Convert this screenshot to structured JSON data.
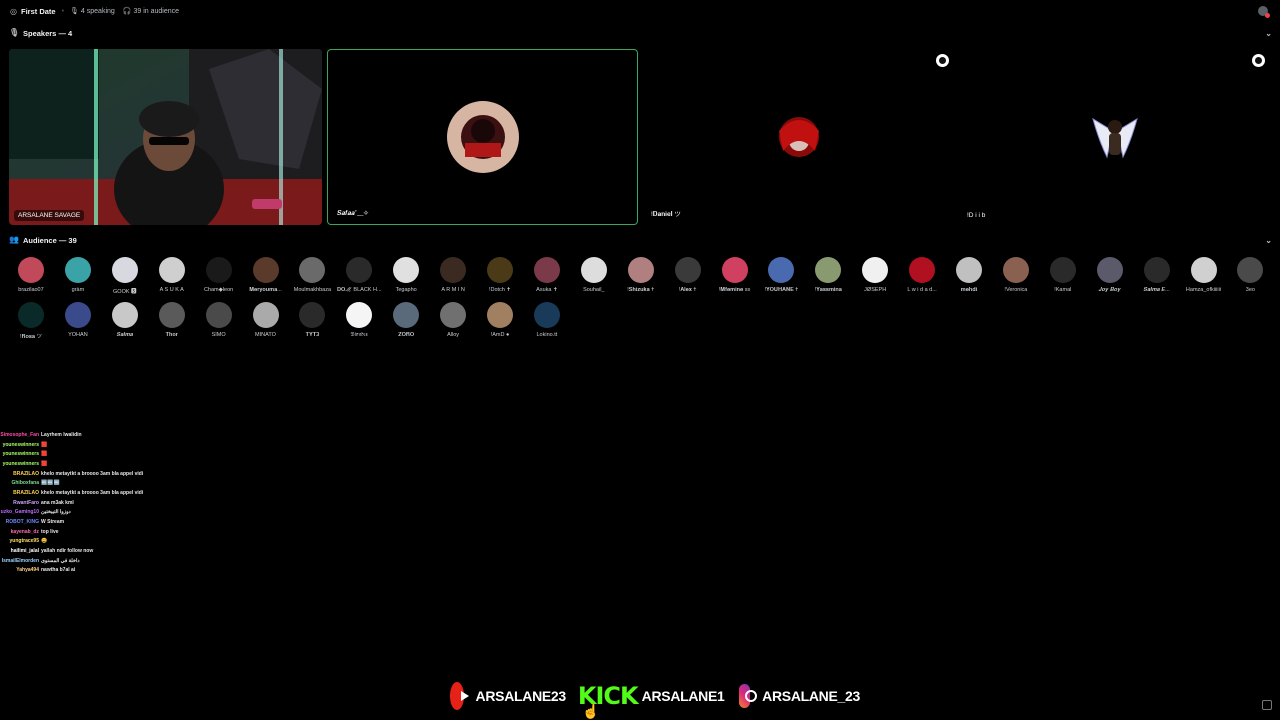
{
  "topbar": {
    "title": "First Date",
    "speaking": "4 speaking",
    "audience": "39 in audience"
  },
  "speakers_header": "Speakers — 4",
  "audience_header": "Audience — 39",
  "speakers": [
    {
      "name": "ARSALANE SAVAGE",
      "bg": "#1a2a24"
    },
    {
      "name": "𝑺𝒂𝒇𝒂𝒂˚﹏✧",
      "bg": "#c2a18c"
    },
    {
      "name": "!𝐃𝐚𝐧𝐢𝐞𝐥 ツ",
      "bg": "#2a070a"
    },
    {
      "name": "!D i i b",
      "bg": "#b3a899"
    }
  ],
  "audience_members": [
    "brazilao07",
    "gràm",
    "GOOK 🆂",
    "A S U K A",
    "Cham◆leon",
    "𝐌𝐞𝐫𝐲𝐨𝐮𝐦𝐚...",
    "Moulmakhbaza",
    "𝐃𝐎ℳ BLACK H...",
    "Tegapho",
    "A R M I N",
    "!Dotch ✝",
    "Asuka ✝",
    "Souhail_",
    "!𝐒𝐡𝐢𝐳𝐮𝐤𝐚 ✝",
    "!𝐀𝐥𝐞𝐱 ✝",
    "!𝐌𝐟𝐞𝐦𝐢𝐧𝐞 ss",
    "!𝐘𝐎𝐔𝐇𝐀𝐍𝐄 ✝",
    "!𝐘𝐚𝐬𝐬𝐦𝐢𝐧𝐚",
    "JØSEPH",
    "L w i d a d...",
    "𝐦𝐞𝐡𝐝𝐢",
    "!Veronica",
    "!Kamal",
    "𝑱𝒐𝒚 𝑩𝒐𝒚",
    "𝑺𝒂𝒍𝒎𝒂 𝑬...",
    "Hamza_ofkiiiiii",
    "3eo",
    "!𝐑𝐨𝐬𝐚 ツ",
    "YOHAN",
    "𝑺𝒂𝒍𝒎𝒂",
    "𝐓𝐡𝐨𝐫",
    "SIMO",
    "MINATO",
    "𝐓𝐘𝐓𝟑",
    "𝔅𝔦𝔬𝔫𝔡𝔢𝔵",
    "𝐙𝐎𝐑𝐎",
    "Alloy",
    "!AmD ●",
    "Lokino.tt"
  ],
  "chat": [
    {
      "user": "Simosophe_Fan",
      "text": "Layrhem lwalidin",
      "color": "#ff4da6"
    },
    {
      "user": "youneswinners",
      "text": "🟥",
      "color": "#a8ff60"
    },
    {
      "user": "youneswinners",
      "text": "🟥",
      "color": "#a8ff60"
    },
    {
      "user": "youneswinners",
      "text": "🟥",
      "color": "#a8ff60"
    },
    {
      "user": "BRAZILAO",
      "text": "khelo metaytkt a broooo 3am bla appel vidi",
      "color": "#ffd24d"
    },
    {
      "user": "Ghiboxfana",
      "text": "🔤🔤🔤",
      "color": "#7fdc8b"
    },
    {
      "user": "BRAZILAO",
      "text": "khelo metaytkt a broooo 3am bla appel vidi",
      "color": "#ffd24d"
    },
    {
      "user": "RwantFaro",
      "text": "ana m3ak kml",
      "color": "#c9a0ff"
    },
    {
      "user": "uzko_Gaming10",
      "text": "دوزوا التيبختين",
      "color": "#bb6bff"
    },
    {
      "user": "ROBOT_KING",
      "text": "W Stream",
      "color": "#6b8bff"
    },
    {
      "user": "kayenab_dz",
      "text": "top live",
      "color": "#ff6bb5"
    },
    {
      "user": "yungtrace95",
      "text": "😄",
      "color": "#ffe066"
    },
    {
      "user": "hailimi_jalal",
      "text": "yallah ndir follow now",
      "color": "#ffffff"
    },
    {
      "user": "IsmailElmorden",
      "text": "داخلة في المستوى",
      "color": "#9ad1ff"
    },
    {
      "user": "Yahya494",
      "text": "nawtha b7al ai",
      "color": "#ffd080"
    }
  ],
  "footer": {
    "youtube_handle": "ARSALANE23",
    "kick_logo": "KICK",
    "kick_handle": "ARSALANE1",
    "instagram_handle": "ARSALANE_23",
    "youtube_color": "#e62117",
    "kick_color": "#53fc18"
  }
}
